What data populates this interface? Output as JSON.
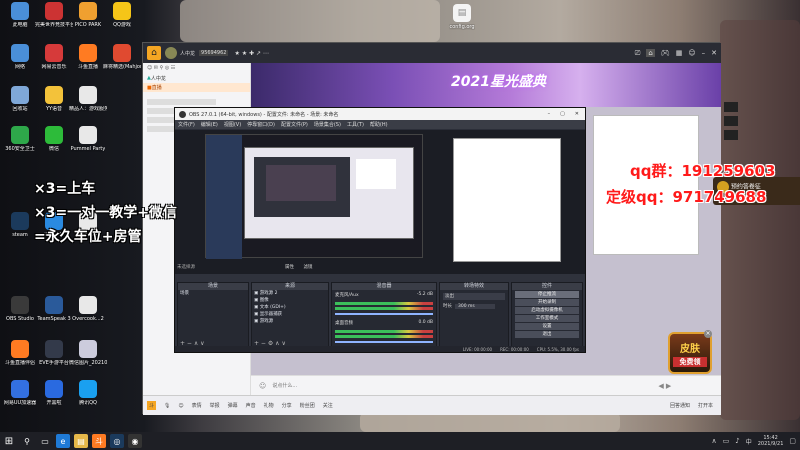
{
  "desktop": {
    "top_icon": {
      "label": "config.org"
    },
    "icons": [
      {
        "label": "此电脑",
        "icon": "pc-icon",
        "color": "#4a8fd8"
      },
      {
        "label": "完美世界竞技平台",
        "icon": "game-platform-icon",
        "color": "#cc3333"
      },
      {
        "label": "PICO PARK",
        "icon": "pico-park-icon",
        "color": "#f0a030"
      },
      {
        "label": "QQ游戏",
        "icon": "qq-game-icon",
        "color": "#f5c518"
      },
      {
        "label": "网络",
        "icon": "network-icon",
        "color": "#4a8fd8"
      },
      {
        "label": "网易云音乐",
        "icon": "netease-music-icon",
        "color": "#d63a3a"
      },
      {
        "label": "斗鱼直播",
        "icon": "douyu-icon",
        "color": "#ff7b22"
      },
      {
        "label": "麻将精选(Mahjong...",
        "icon": "mahjong-icon",
        "color": "#e04a30"
      },
      {
        "label": "回收站",
        "icon": "recycle-bin-icon",
        "color": "#7fa8d8"
      },
      {
        "label": "YY语音",
        "icon": "yy-icon",
        "color": "#f3c23a"
      },
      {
        "label": "精品人：游戏服务器",
        "icon": "document-icon",
        "color": "#e8e8e8"
      },
      {
        "label": "360安全卫士",
        "icon": "safe-360-icon",
        "color": "#2ea84a"
      },
      {
        "label": "微信",
        "icon": "wechat-icon",
        "color": "#2dbb3a"
      },
      {
        "label": "Pummel Party",
        "icon": "document-icon",
        "color": "#e8e8e8"
      },
      {
        "label": "steam",
        "icon": "steam-icon",
        "color": "#1b3a5c"
      },
      {
        "label": "迅雷影音",
        "icon": "thunder-player-icon",
        "color": "#2a8ae0"
      },
      {
        "label": "DEVOUR",
        "icon": "document-icon",
        "color": "#e8e8e8"
      },
      {
        "label": "OBS Studio",
        "icon": "obs-icon",
        "color": "#3a3a3a"
      },
      {
        "label": "TeamSpeak 3",
        "icon": "teamspeak-icon",
        "color": "#2a5a9a"
      },
      {
        "label": "Overcook...2",
        "icon": "document-icon",
        "color": "#e8e8e8"
      },
      {
        "label": "斗鱼直播伴侣",
        "icon": "douyu-companion-icon",
        "color": "#ff7b22"
      },
      {
        "label": "EVE手游平台",
        "icon": "eve-icon",
        "color": "#333a4a"
      },
      {
        "label": "微信图片_2021091...",
        "icon": "image-file-icon",
        "color": "#ccd"
      },
      {
        "label": "网易UU加速器",
        "icon": "uu-accelerator-icon",
        "color": "#3370e0"
      },
      {
        "label": "开黑啦",
        "icon": "kaiheila-icon",
        "color": "#2a6ae0"
      },
      {
        "label": "腾讯QQ",
        "icon": "qq-icon",
        "color": "#1aa0f0"
      }
    ]
  },
  "overlay": {
    "line1": "×3=上车",
    "line2": "×3=一对一教学+微信",
    "line3": "=永久车位+房管",
    "qq1": "qq群：191259603",
    "qq2": "定级qq：971749688"
  },
  "app": {
    "host_name": "人中龙",
    "room_id": "95694962",
    "left_panel": {
      "header": "人中龙",
      "tab": "直播"
    },
    "banner_text": "2021星光盛典",
    "badge_text": "预约答卷征",
    "chat_placeholder": "说点什么...",
    "bottom_bar": [
      "表情",
      "举报",
      "弹幕",
      "声音",
      "礼物",
      "分享",
      "粉丝团",
      "关注"
    ],
    "promo": {
      "line1": "皮肤",
      "line2": "免费领"
    },
    "right_footer": [
      "回答通知",
      "打开本"
    ]
  },
  "obs": {
    "title": "OBS 27.0.1 (64-bit, windows) - 配置文件: 未命名 - 场景: 未命名",
    "menu": [
      "文件(F)",
      "编辑(E)",
      "视图(V)",
      "停靠窗口(D)",
      "配置文件(P)",
      "场景集合(S)",
      "工具(T)",
      "帮助(H)"
    ],
    "preview_tabs": [
      "属性",
      "滤镜"
    ],
    "no_source_label": "未选择源",
    "docks": {
      "scenes": {
        "title": "场景",
        "items": [
          "场景"
        ]
      },
      "sources": {
        "title": "来源",
        "items": [
          "游戏源 2",
          "图像",
          "文本 (GDI+)",
          "显示器捕获",
          "游戏源"
        ]
      },
      "mixer": {
        "title": "混音器",
        "channels": [
          {
            "name": "麦克风/Aux",
            "db": "-5.2 dB"
          },
          {
            "name": "桌面音频",
            "db": "0.0 dB"
          }
        ]
      },
      "transitions": {
        "title": "转场特效",
        "type": "淡出",
        "duration_label": "时长",
        "duration": "300 ms"
      },
      "controls": {
        "title": "控件",
        "buttons": [
          "停止推流",
          "开始录制",
          "启动虚拟摄像机",
          "工作室模式",
          "设置",
          "退出"
        ]
      }
    },
    "status": {
      "live": "LIVE: 00:00:00",
      "rec": "REC: 00:00:00",
      "cpu": "CPU: 5.5%, 30.00 fps"
    }
  },
  "taskbar": {
    "time": "15:42",
    "date": "2021/9/21",
    "lang": "中"
  },
  "colors": {
    "accent_purple": "#7a4fb5",
    "overlay_red": "#ff1a1a",
    "obs_dark": "#2b2e38",
    "taskbar": "#1e1f25"
  }
}
